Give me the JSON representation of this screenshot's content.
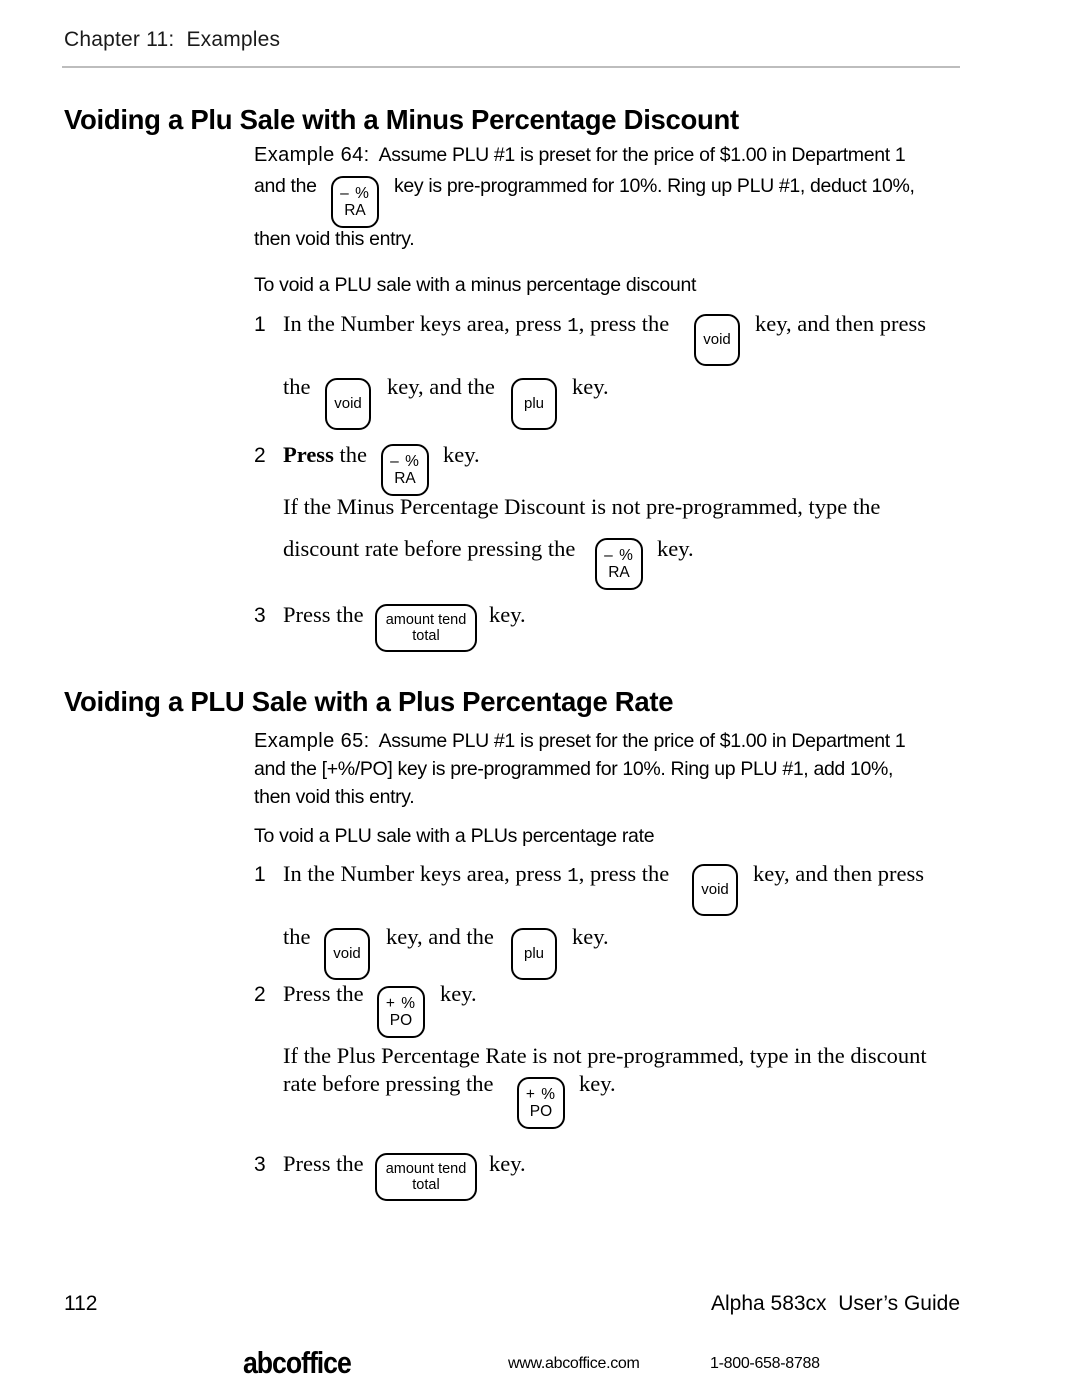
{
  "page": {
    "running_head": "Chapter 11:  Examples",
    "folio": "112",
    "guide_title": "Alpha 583cx  User’s Guide"
  },
  "footer": {
    "brand": "abcoffice",
    "url": "www.abcoffice.com",
    "phone": "1-800-658-8788"
  },
  "keys": {
    "minus_pct_line1": "– %",
    "minus_pct_line2": "RA",
    "plus_pct_line1": "+ %",
    "plus_pct_line2": "PO",
    "void": "void",
    "plu": "plu",
    "amount_tend_line1": "amount tend",
    "amount_tend_line2": "total"
  },
  "section1": {
    "title": "Voiding a Plu Sale with a Minus Percentage Discount",
    "example_label": "Example 64:",
    "example_l1": "Assume PLU #1 is preset for the price of $1.00 in Department 1",
    "example_l2a": "and the",
    "example_l2b": "key is pre-programmed for 10%. Ring up PLU #1, deduct 10%,",
    "example_l3": "then void this entry.",
    "subhead": "To void a PLU sale with a minus percentage discount",
    "step1_num": "1",
    "step1_a": "In the Number keys area, press",
    "step1_mono": "1",
    "step1_b": ", press the",
    "step1_c": "key, and then press",
    "step1_d": "the",
    "step1_e": "key, and the",
    "step1_f": "key.",
    "step2_num": "2",
    "step2_a": "Press",
    "step2_b": "the",
    "step2_c": "key.",
    "step2_note_l1": "If the Minus Percentage Discount is not pre-programmed, type the",
    "step2_note_l2a": "discount rate before pressing the",
    "step2_note_l2b": "key.",
    "step3_num": "3",
    "step3_a": "Press the",
    "step3_b": "key."
  },
  "section2": {
    "title": "Voiding a PLU Sale with a Plus Percentage Rate",
    "example_label": "Example 65:",
    "example_l1": "Assume PLU #1 is preset for the price of $1.00 in Department 1",
    "example_l2": "and the [+%/PO] key is pre-programmed for 10%. Ring up PLU #1, add 10%,",
    "example_l3": "then void this entry.",
    "subhead": "To void a PLU sale with a PLUs percentage rate",
    "step1_num": "1",
    "step1_a": "In the Number keys area, press",
    "step1_mono": "1",
    "step1_b": ", press the",
    "step1_c": "key, and then press",
    "step1_d": "the",
    "step1_e": "key, and the",
    "step1_f": "key.",
    "step2_num": "2",
    "step2_a": "Press the",
    "step2_b": "key.",
    "step2_note_l1": "If the Plus Percentage Rate is not pre-programmed, type in the discount",
    "step2_note_l2a": "rate before pressing the",
    "step2_note_l2b": "key.",
    "step3_num": "3",
    "step3_a": "Press the",
    "step3_b": "key."
  }
}
